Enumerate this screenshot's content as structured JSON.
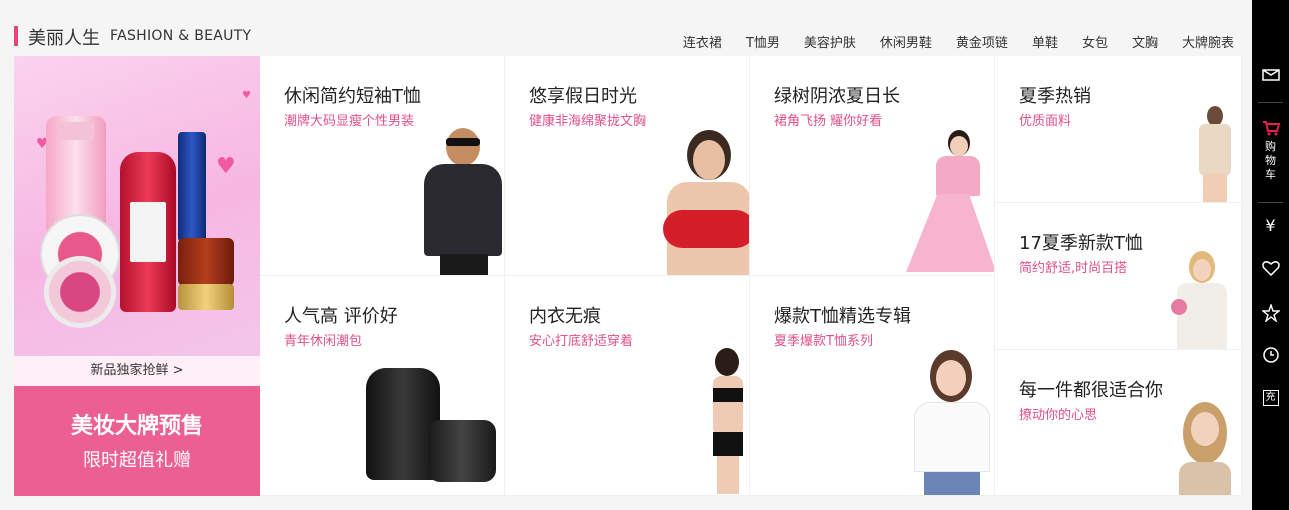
{
  "header": {
    "title": "美丽人生",
    "subtitle": "FASHION & BEAUTY",
    "nav": [
      "连衣裙",
      "T恤男",
      "美容护肤",
      "休闲男鞋",
      "黄金项链",
      "单鞋",
      "女包",
      "文胸",
      "大牌腕表"
    ]
  },
  "promo": {
    "link_label": "新品独家抢鲜 >",
    "banner_line1": "美妆大牌预售",
    "banner_line2": "限时超值礼赠"
  },
  "cards": [
    {
      "title": "休闲简约短袖T恤",
      "subtitle": "潮牌大码显瘦个性男装"
    },
    {
      "title": "悠享假日时光",
      "subtitle": "健康非海绵聚拢文胸"
    },
    {
      "title": "绿树阴浓夏日长",
      "subtitle": "裙角飞扬 耀你好看"
    },
    {
      "title": "夏季热销",
      "subtitle": "优质面料"
    },
    {
      "title": "17夏季新款T恤",
      "subtitle": "简约舒适,时尚百搭"
    },
    {
      "title": "人气高 评价好",
      "subtitle": "青年休闲潮包"
    },
    {
      "title": "内衣无痕",
      "subtitle": "安心打底舒适穿着"
    },
    {
      "title": "爆款T恤精选专辑",
      "subtitle": "夏季爆款T恤系列"
    },
    {
      "title": "每一件都很适合你",
      "subtitle": "撩动你的心思"
    }
  ],
  "sidebar": {
    "cart_label": "购物车",
    "icons": [
      "account-icon",
      "cart-icon",
      "yen-icon",
      "heart-icon",
      "star-icon",
      "history-icon",
      "recharge-icon"
    ],
    "recharge_label": "充"
  },
  "colors": {
    "accent": "#e6457a",
    "banner": "#ec5f91",
    "subtitle": "#e0508a"
  }
}
